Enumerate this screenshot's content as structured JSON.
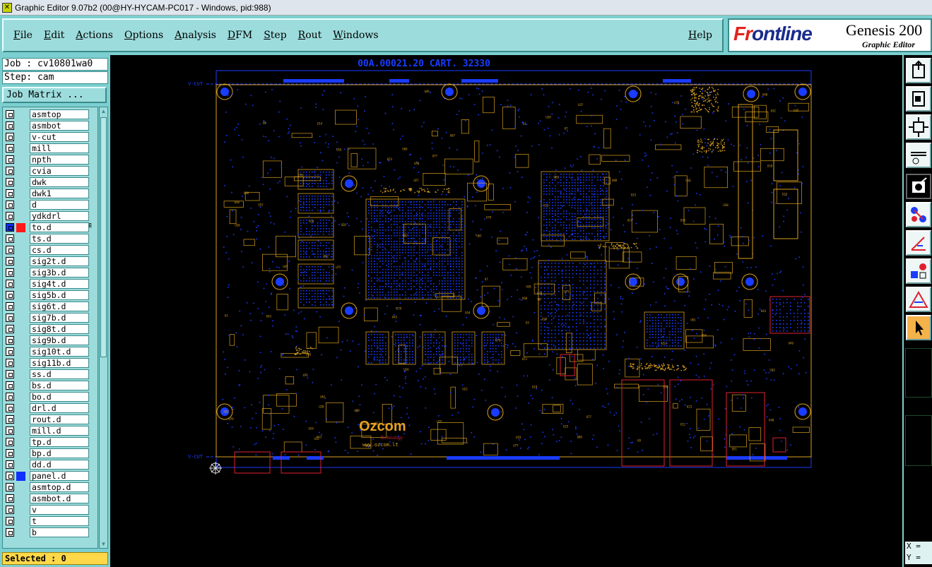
{
  "window": {
    "title": "Graphic Editor 9.07b2 (00@HY-HYCAM-PC017 - Windows, pid:988)"
  },
  "menu": {
    "items": [
      "File",
      "Edit",
      "Actions",
      "Options",
      "Analysis",
      "DFM",
      "Step",
      "Rout",
      "Windows"
    ],
    "help": "Help"
  },
  "brand": {
    "logo_a": "Fr",
    "logo_b": "ontline",
    "product": "Genesis 200",
    "subtitle": "Graphic Editor"
  },
  "job": {
    "label": "Job : cv10801wa0",
    "step": "Step: cam",
    "matrix_button": "Job Matrix ..."
  },
  "layers": [
    {
      "name": "asmtop",
      "flag": "✍"
    },
    {
      "name": "asmbot",
      "flag": "✍"
    },
    {
      "name": "v-cut",
      "flag": ""
    },
    {
      "name": "mill",
      "flag": ""
    },
    {
      "name": "npth",
      "flag": ""
    },
    {
      "name": "cvia",
      "flag": ""
    },
    {
      "name": "dwk",
      "flag": ""
    },
    {
      "name": "dwk1",
      "flag": ""
    },
    {
      "name": "d",
      "flag": ""
    },
    {
      "name": "ydkdrl",
      "flag": ""
    },
    {
      "name": "to.d",
      "flag": "✍⊞",
      "color": "#ff1a1a",
      "active": true
    },
    {
      "name": "ts.d",
      "flag": ""
    },
    {
      "name": "cs.d",
      "flag": ""
    },
    {
      "name": "sig2t.d",
      "flag": ""
    },
    {
      "name": "sig3b.d",
      "flag": ""
    },
    {
      "name": "sig4t.d",
      "flag": ""
    },
    {
      "name": "sig5b.d",
      "flag": ""
    },
    {
      "name": "sig6t.d",
      "flag": ""
    },
    {
      "name": "sig7b.d",
      "flag": ""
    },
    {
      "name": "sig8t.d",
      "flag": ""
    },
    {
      "name": "sig9b.d",
      "flag": ""
    },
    {
      "name": "sig10t.d",
      "flag": ""
    },
    {
      "name": "sig11b.d",
      "flag": ""
    },
    {
      "name": "ss.d",
      "flag": ""
    },
    {
      "name": "bs.d",
      "flag": ""
    },
    {
      "name": "bo.d",
      "flag": "✍"
    },
    {
      "name": "drl.d",
      "flag": ""
    },
    {
      "name": "rout.d",
      "flag": ""
    },
    {
      "name": "mill.d",
      "flag": ""
    },
    {
      "name": "tp.d",
      "flag": ""
    },
    {
      "name": "bp.d",
      "flag": ""
    },
    {
      "name": "dd.d",
      "flag": ""
    },
    {
      "name": "panel.d",
      "flag": "",
      "color": "#1030ff"
    },
    {
      "name": "asmtop.d",
      "flag": "✍"
    },
    {
      "name": "asmbot.d",
      "flag": "✍"
    },
    {
      "name": "v",
      "flag": ""
    },
    {
      "name": "t",
      "flag": ""
    },
    {
      "name": "b",
      "flag": ""
    }
  ],
  "status": {
    "selected": "Selected : 0"
  },
  "canvas": {
    "board_title": "00A.00021.20 CART. 32330",
    "vcut_top": "V-CUT",
    "vcut_bottom": "V-CUT",
    "vendor_logo": "Ozcom",
    "vendor_sub": "Technology",
    "vendor_url": "www.ozcom.lt",
    "colors": {
      "trace": "#1a3cff",
      "silk": "#d8a020",
      "outline": "#e02030"
    }
  },
  "coords": {
    "x": "X =",
    "y": "Y ="
  },
  "toolbar_icons": [
    "zoom-home-icon",
    "zoom-window-icon",
    "zoom-fit-icon",
    "measure-icon",
    "select-icon",
    "snap-icon",
    "display-icon",
    "filter-icon",
    "features-icon",
    "pointer-icon"
  ]
}
